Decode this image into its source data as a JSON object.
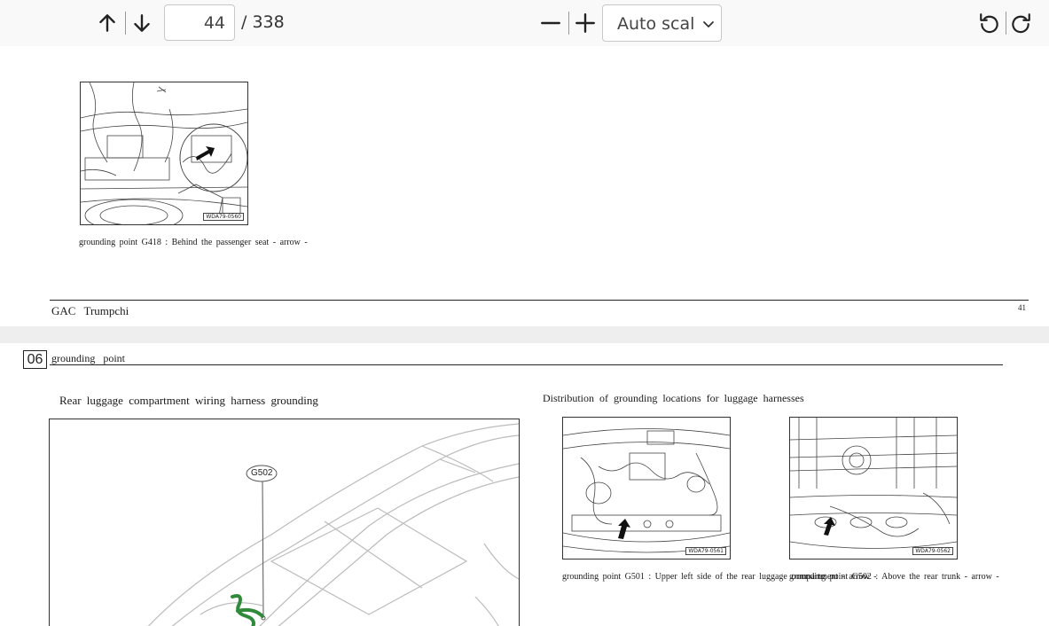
{
  "toolbar": {
    "prev_icon": "arrow-up-icon",
    "next_icon": "arrow-down-icon",
    "page_number": "44",
    "page_total": "/ 338",
    "zoom_out_icon": "minus-icon",
    "zoom_in_icon": "plus-icon",
    "zoom_value": "Auto scaling",
    "rotate_ccw_icon": "rotate-ccw-icon",
    "rotate_cw_icon": "rotate-cw-icon"
  },
  "page1": {
    "figure_id": "WDA79-0560",
    "caption": "grounding point G418 : Behind the passenger seat - arrow -",
    "footer_brand": "GAC Trumpchi",
    "page_number": "41"
  },
  "page2": {
    "section_number": "06",
    "section_title": "grounding point",
    "left_heading": "Rear luggage compartment wiring harness grounding",
    "callout_label": "G502",
    "right_heading": "Distribution of grounding locations for luggage harnesses",
    "figure_a_id": "WDA79-0561",
    "figure_b_id": "WDA79-0562",
    "caption_a": "grounding point G501 : Upper left side of the rear luggage compartment - arrow -",
    "caption_b": "grounding point G502 : Above the rear trunk - arrow -"
  },
  "colors": {
    "toolbar_bg": "#f9f9fa",
    "viewer_bg": "#eeeeee",
    "harness_green": "#2f8a3a"
  }
}
